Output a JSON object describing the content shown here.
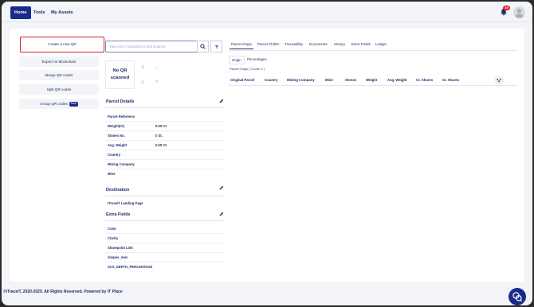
{
  "nav": {
    "home": "Home",
    "tools": "Tools",
    "my_assets": "My Assets",
    "notification_count": "29"
  },
  "sidebar": {
    "items": [
      {
        "label": "Create a new QR"
      },
      {
        "label": "Export on blockchain"
      },
      {
        "label": "Merge QR codes"
      },
      {
        "label": "Split QR codes"
      },
      {
        "label": "Group QR codes",
        "badge": "New"
      }
    ]
  },
  "search": {
    "placeholder": "Type min 3 characters to find a parcel"
  },
  "qr": {
    "status": "No QR scanned"
  },
  "parcel_details": {
    "title": "Parcel Details",
    "rows": [
      {
        "key": "Parcel Reference",
        "value": ""
      },
      {
        "key": "Weight(Ct)",
        "value": "0.00 Ct."
      },
      {
        "key": "Stones No.",
        "value": "0 St."
      },
      {
        "key": "Avg. Weight",
        "value": "0.00 Ct."
      },
      {
        "key": "Country",
        "value": ""
      },
      {
        "key": "Mining Company",
        "value": ""
      },
      {
        "key": "Mine",
        "value": ""
      }
    ]
  },
  "destination": {
    "title": "Destination",
    "rows": [
      {
        "key": "iTraceiT Landing Page"
      }
    ]
  },
  "extra_fields": {
    "title": "Extra Fields",
    "rows": [
      {
        "key": "Color"
      },
      {
        "key": "Clarity"
      },
      {
        "key": "Sharepoint Link"
      },
      {
        "key": "shapes_new"
      },
      {
        "key": "SCS_DEPTH_PERCENTAGE"
      }
    ]
  },
  "tabs": [
    "Parcel Origin",
    "Parcel Child's",
    "Traceability",
    "Documents",
    "History",
    "Extra Fields",
    "Ledger"
  ],
  "subtabs": [
    "Origin",
    "Percentages"
  ],
  "origin_meta": "Parcel Origin | Count: 0 |",
  "table": {
    "columns": [
      "Original Parcel",
      "Country",
      "Mining Company",
      "Mine",
      "Stones",
      "Weight",
      "Avg. Weight",
      "Ct. Shares",
      "St. Shares"
    ]
  },
  "footer": {
    "text": "©iTraceiT, 2020-2025. All Rights Reserved. Powered by ",
    "link": "IT Place"
  },
  "colors": {
    "primary": "#1a2a8a",
    "highlight_border": "#d4202a",
    "badge": "#e0232e"
  },
  "icons": [
    "bell-icon",
    "avatar-icon",
    "search-icon",
    "filter-icon",
    "edit-icon",
    "columns-icon",
    "chat-icon"
  ]
}
